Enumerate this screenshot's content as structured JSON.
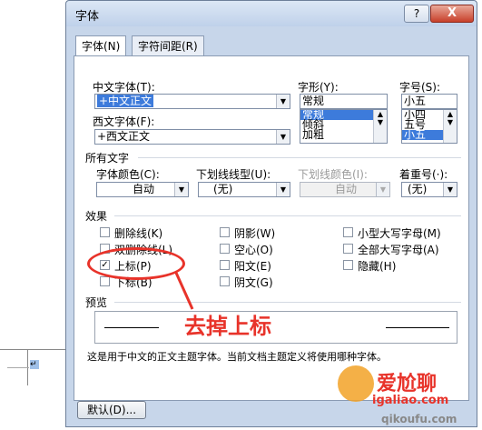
{
  "dialog": {
    "title": "字体",
    "help_glyph": "?",
    "close_glyph": "X",
    "tabs": [
      {
        "label": "字体(N)",
        "active": true
      },
      {
        "label": "字符间距(R)",
        "active": false
      }
    ]
  },
  "font": {
    "chinese_font_label": "中文字体(T):",
    "chinese_font_value": "+中文正文",
    "western_font_label": "西文字体(F):",
    "western_font_value": "+西文正文",
    "style_label": "字形(Y):",
    "style_value": "常规",
    "style_options": [
      "常规",
      "倾斜",
      "加粗"
    ],
    "style_selected": "常规",
    "size_label": "字号(S):",
    "size_value": "小五",
    "size_options": [
      "小四",
      "五号",
      "小五"
    ],
    "size_selected": "小五"
  },
  "all_text": {
    "section_label": "所有文字",
    "font_color_label": "字体颜色(C):",
    "font_color_value": "自动",
    "underline_label": "下划线线型(U):",
    "underline_value": "(无)",
    "underline_color_label": "下划线颜色(I):",
    "underline_color_value": "自动",
    "emphasis_label": "着重号(·):",
    "emphasis_value": "(无)"
  },
  "effects": {
    "section_label": "效果",
    "items": [
      {
        "label": "删除线(K)",
        "checked": false
      },
      {
        "label": "双删除线(L)",
        "checked": false
      },
      {
        "label": "上标(P)",
        "checked": true
      },
      {
        "label": "下标(B)",
        "checked": false
      },
      {
        "label": "阴影(W)",
        "checked": false
      },
      {
        "label": "空心(O)",
        "checked": false
      },
      {
        "label": "阳文(E)",
        "checked": false
      },
      {
        "label": "阴文(G)",
        "checked": false
      },
      {
        "label": "小型大写字母(M)",
        "checked": false
      },
      {
        "label": "全部大写字母(A)",
        "checked": false
      },
      {
        "label": "隐藏(H)",
        "checked": false
      }
    ]
  },
  "preview": {
    "section_label": "预览",
    "note": "这是用于中文的正文主题字体。当前文档主题定义将使用哪种字体。"
  },
  "buttons": {
    "default_label": "默认(D)..."
  },
  "annotation": {
    "text": "去掉上标",
    "color": "#e8332a"
  },
  "watermark": {
    "text": "爱尬聊",
    "url": "igaliao.com",
    "url2": "qikoufu.com"
  }
}
